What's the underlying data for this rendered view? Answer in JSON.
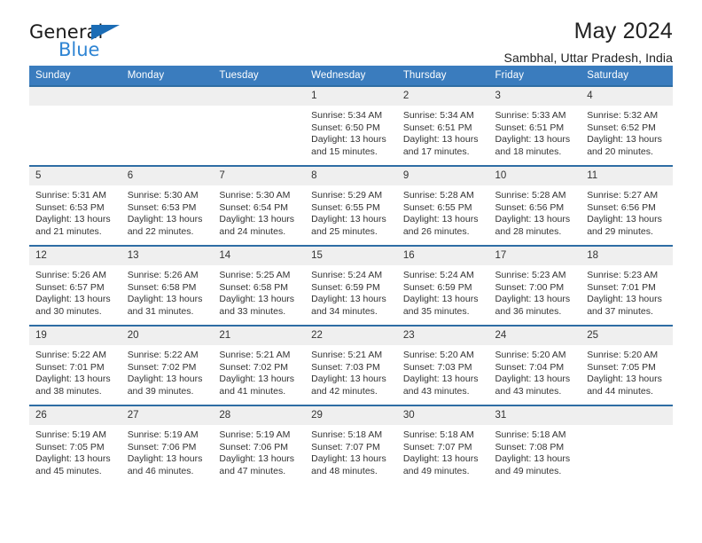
{
  "logo": {
    "word_one": "General",
    "word_two": "Blue",
    "triangle_color": "#1b6cb5",
    "blue_color": "#2e84d3"
  },
  "header": {
    "title": "May 2024",
    "subtitle": "Sambhal, Uttar Pradesh, India"
  },
  "theme": {
    "header_blue": "#3a7cbe",
    "row_border_blue": "#2e6da4",
    "daynum_bg": "#efefef"
  },
  "calendar": {
    "weekdays": [
      "Sunday",
      "Monday",
      "Tuesday",
      "Wednesday",
      "Thursday",
      "Friday",
      "Saturday"
    ],
    "labels": {
      "sunrise": "Sunrise:",
      "sunset": "Sunset:",
      "daylight": "Daylight:"
    },
    "weeks": [
      [
        {
          "day": ""
        },
        {
          "day": ""
        },
        {
          "day": ""
        },
        {
          "day": "1",
          "sunrise": "Sunrise: 5:34 AM",
          "sunset": "Sunset: 6:50 PM",
          "daylight_1": "Daylight: 13 hours",
          "daylight_2": "and 15 minutes."
        },
        {
          "day": "2",
          "sunrise": "Sunrise: 5:34 AM",
          "sunset": "Sunset: 6:51 PM",
          "daylight_1": "Daylight: 13 hours",
          "daylight_2": "and 17 minutes."
        },
        {
          "day": "3",
          "sunrise": "Sunrise: 5:33 AM",
          "sunset": "Sunset: 6:51 PM",
          "daylight_1": "Daylight: 13 hours",
          "daylight_2": "and 18 minutes."
        },
        {
          "day": "4",
          "sunrise": "Sunrise: 5:32 AM",
          "sunset": "Sunset: 6:52 PM",
          "daylight_1": "Daylight: 13 hours",
          "daylight_2": "and 20 minutes."
        }
      ],
      [
        {
          "day": "5",
          "sunrise": "Sunrise: 5:31 AM",
          "sunset": "Sunset: 6:53 PM",
          "daylight_1": "Daylight: 13 hours",
          "daylight_2": "and 21 minutes."
        },
        {
          "day": "6",
          "sunrise": "Sunrise: 5:30 AM",
          "sunset": "Sunset: 6:53 PM",
          "daylight_1": "Daylight: 13 hours",
          "daylight_2": "and 22 minutes."
        },
        {
          "day": "7",
          "sunrise": "Sunrise: 5:30 AM",
          "sunset": "Sunset: 6:54 PM",
          "daylight_1": "Daylight: 13 hours",
          "daylight_2": "and 24 minutes."
        },
        {
          "day": "8",
          "sunrise": "Sunrise: 5:29 AM",
          "sunset": "Sunset: 6:55 PM",
          "daylight_1": "Daylight: 13 hours",
          "daylight_2": "and 25 minutes."
        },
        {
          "day": "9",
          "sunrise": "Sunrise: 5:28 AM",
          "sunset": "Sunset: 6:55 PM",
          "daylight_1": "Daylight: 13 hours",
          "daylight_2": "and 26 minutes."
        },
        {
          "day": "10",
          "sunrise": "Sunrise: 5:28 AM",
          "sunset": "Sunset: 6:56 PM",
          "daylight_1": "Daylight: 13 hours",
          "daylight_2": "and 28 minutes."
        },
        {
          "day": "11",
          "sunrise": "Sunrise: 5:27 AM",
          "sunset": "Sunset: 6:56 PM",
          "daylight_1": "Daylight: 13 hours",
          "daylight_2": "and 29 minutes."
        }
      ],
      [
        {
          "day": "12",
          "sunrise": "Sunrise: 5:26 AM",
          "sunset": "Sunset: 6:57 PM",
          "daylight_1": "Daylight: 13 hours",
          "daylight_2": "and 30 minutes."
        },
        {
          "day": "13",
          "sunrise": "Sunrise: 5:26 AM",
          "sunset": "Sunset: 6:58 PM",
          "daylight_1": "Daylight: 13 hours",
          "daylight_2": "and 31 minutes."
        },
        {
          "day": "14",
          "sunrise": "Sunrise: 5:25 AM",
          "sunset": "Sunset: 6:58 PM",
          "daylight_1": "Daylight: 13 hours",
          "daylight_2": "and 33 minutes."
        },
        {
          "day": "15",
          "sunrise": "Sunrise: 5:24 AM",
          "sunset": "Sunset: 6:59 PM",
          "daylight_1": "Daylight: 13 hours",
          "daylight_2": "and 34 minutes."
        },
        {
          "day": "16",
          "sunrise": "Sunrise: 5:24 AM",
          "sunset": "Sunset: 6:59 PM",
          "daylight_1": "Daylight: 13 hours",
          "daylight_2": "and 35 minutes."
        },
        {
          "day": "17",
          "sunrise": "Sunrise: 5:23 AM",
          "sunset": "Sunset: 7:00 PM",
          "daylight_1": "Daylight: 13 hours",
          "daylight_2": "and 36 minutes."
        },
        {
          "day": "18",
          "sunrise": "Sunrise: 5:23 AM",
          "sunset": "Sunset: 7:01 PM",
          "daylight_1": "Daylight: 13 hours",
          "daylight_2": "and 37 minutes."
        }
      ],
      [
        {
          "day": "19",
          "sunrise": "Sunrise: 5:22 AM",
          "sunset": "Sunset: 7:01 PM",
          "daylight_1": "Daylight: 13 hours",
          "daylight_2": "and 38 minutes."
        },
        {
          "day": "20",
          "sunrise": "Sunrise: 5:22 AM",
          "sunset": "Sunset: 7:02 PM",
          "daylight_1": "Daylight: 13 hours",
          "daylight_2": "and 39 minutes."
        },
        {
          "day": "21",
          "sunrise": "Sunrise: 5:21 AM",
          "sunset": "Sunset: 7:02 PM",
          "daylight_1": "Daylight: 13 hours",
          "daylight_2": "and 41 minutes."
        },
        {
          "day": "22",
          "sunrise": "Sunrise: 5:21 AM",
          "sunset": "Sunset: 7:03 PM",
          "daylight_1": "Daylight: 13 hours",
          "daylight_2": "and 42 minutes."
        },
        {
          "day": "23",
          "sunrise": "Sunrise: 5:20 AM",
          "sunset": "Sunset: 7:03 PM",
          "daylight_1": "Daylight: 13 hours",
          "daylight_2": "and 43 minutes."
        },
        {
          "day": "24",
          "sunrise": "Sunrise: 5:20 AM",
          "sunset": "Sunset: 7:04 PM",
          "daylight_1": "Daylight: 13 hours",
          "daylight_2": "and 43 minutes."
        },
        {
          "day": "25",
          "sunrise": "Sunrise: 5:20 AM",
          "sunset": "Sunset: 7:05 PM",
          "daylight_1": "Daylight: 13 hours",
          "daylight_2": "and 44 minutes."
        }
      ],
      [
        {
          "day": "26",
          "sunrise": "Sunrise: 5:19 AM",
          "sunset": "Sunset: 7:05 PM",
          "daylight_1": "Daylight: 13 hours",
          "daylight_2": "and 45 minutes."
        },
        {
          "day": "27",
          "sunrise": "Sunrise: 5:19 AM",
          "sunset": "Sunset: 7:06 PM",
          "daylight_1": "Daylight: 13 hours",
          "daylight_2": "and 46 minutes."
        },
        {
          "day": "28",
          "sunrise": "Sunrise: 5:19 AM",
          "sunset": "Sunset: 7:06 PM",
          "daylight_1": "Daylight: 13 hours",
          "daylight_2": "and 47 minutes."
        },
        {
          "day": "29",
          "sunrise": "Sunrise: 5:18 AM",
          "sunset": "Sunset: 7:07 PM",
          "daylight_1": "Daylight: 13 hours",
          "daylight_2": "and 48 minutes."
        },
        {
          "day": "30",
          "sunrise": "Sunrise: 5:18 AM",
          "sunset": "Sunset: 7:07 PM",
          "daylight_1": "Daylight: 13 hours",
          "daylight_2": "and 49 minutes."
        },
        {
          "day": "31",
          "sunrise": "Sunrise: 5:18 AM",
          "sunset": "Sunset: 7:08 PM",
          "daylight_1": "Daylight: 13 hours",
          "daylight_2": "and 49 minutes."
        },
        {
          "day": ""
        }
      ]
    ]
  }
}
